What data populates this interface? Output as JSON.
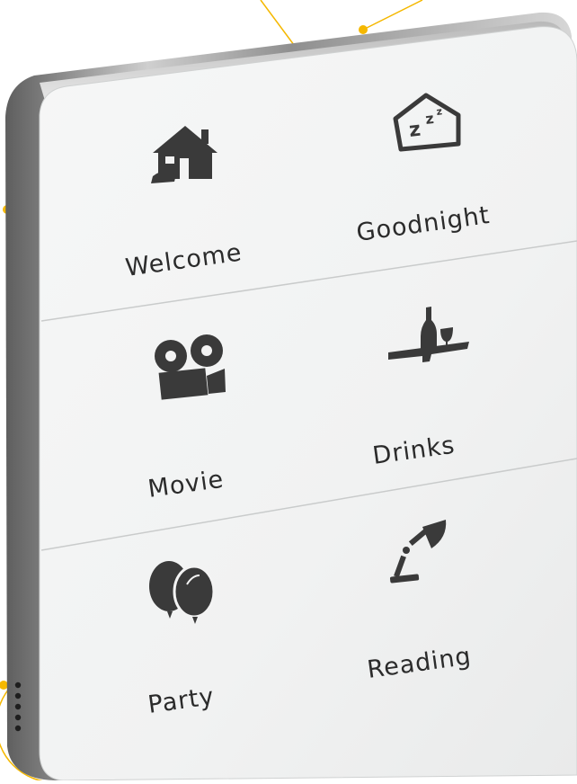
{
  "panel": {
    "buttons": [
      {
        "label": "Welcome",
        "icon": "house-icon"
      },
      {
        "label": "Goodnight",
        "icon": "sleep-house-icon"
      },
      {
        "label": "Movie",
        "icon": "movie-camera-icon"
      },
      {
        "label": "Drinks",
        "icon": "bottle-glass-icon"
      },
      {
        "label": "Party",
        "icon": "balloons-icon"
      },
      {
        "label": "Reading",
        "icon": "desk-lamp-icon"
      }
    ]
  },
  "colors": {
    "icon": "#3a3a3a",
    "accent": "#f5b800",
    "frame": "#8a8a8a",
    "glass": "#f4f5f5"
  }
}
